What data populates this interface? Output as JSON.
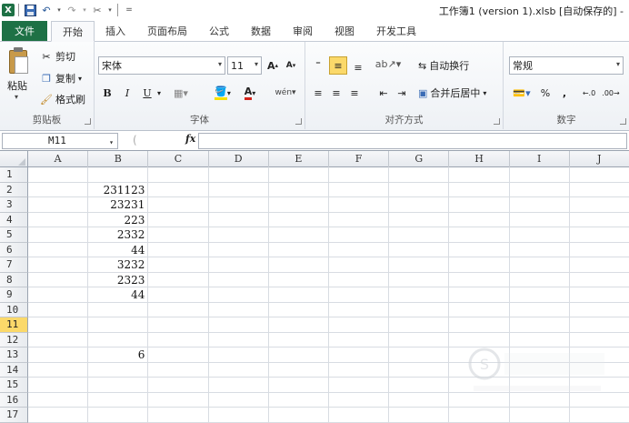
{
  "window": {
    "title": "工作簿1 (version 1).xlsb [自动保存的] -"
  },
  "ribbon_tabs": [
    {
      "label": "文件"
    },
    {
      "label": "开始"
    },
    {
      "label": "插入"
    },
    {
      "label": "页面布局"
    },
    {
      "label": "公式"
    },
    {
      "label": "数据"
    },
    {
      "label": "审阅"
    },
    {
      "label": "视图"
    },
    {
      "label": "开发工具"
    }
  ],
  "clipboard": {
    "paste": "粘贴",
    "cut": "剪切",
    "copy": "复制",
    "format_painter": "格式刷",
    "group": "剪贴板"
  },
  "font": {
    "name": "宋体",
    "size": "11",
    "group": "字体",
    "bold": "B",
    "italic": "I",
    "underline": "U"
  },
  "alignment": {
    "wrap": "自动换行",
    "merge": "合并后居中",
    "group": "对齐方式"
  },
  "number": {
    "format": "常规",
    "group": "数字",
    "percent": "%",
    "comma": ","
  },
  "formula_bar": {
    "name_box": "M11",
    "fx": "fx",
    "value": ""
  },
  "columns": [
    "A",
    "B",
    "C",
    "D",
    "E",
    "F",
    "G",
    "H",
    "I",
    "J"
  ],
  "rows": [
    "1",
    "2",
    "3",
    "4",
    "5",
    "6",
    "7",
    "8",
    "9",
    "10",
    "11",
    "12",
    "13",
    "14",
    "15",
    "16",
    "17"
  ],
  "selected_row": "11",
  "cells": [
    {
      "ref": "B2",
      "value": "231123"
    },
    {
      "ref": "B3",
      "value": "23231"
    },
    {
      "ref": "B4",
      "value": "223"
    },
    {
      "ref": "B5",
      "value": "2332"
    },
    {
      "ref": "B6",
      "value": "44"
    },
    {
      "ref": "B7",
      "value": "3232"
    },
    {
      "ref": "B8",
      "value": "2323"
    },
    {
      "ref": "B9",
      "value": "44"
    },
    {
      "ref": "B13",
      "value": "6"
    }
  ]
}
